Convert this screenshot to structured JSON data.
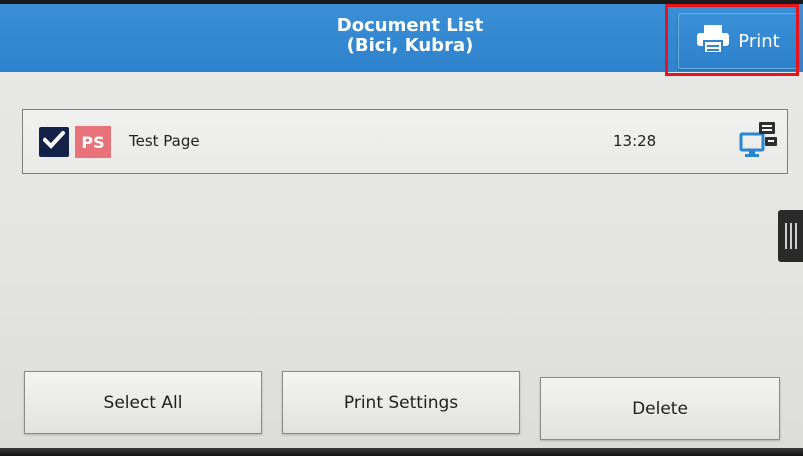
{
  "header": {
    "title_line1": "Document List",
    "title_line2": "(Bici, Kubra)",
    "print_button": {
      "label": "Print",
      "icon": "printer-icon"
    }
  },
  "documents": [
    {
      "checked": true,
      "type_badge": "PS",
      "name": "Test Page",
      "time": "13:28",
      "source_icon": "pc-monitor-icon"
    }
  ],
  "footer": {
    "select_all_label": "Select All",
    "print_settings_label": "Print Settings",
    "delete_label": "Delete"
  },
  "colors": {
    "header_blue": "#3a8fd6",
    "checkbox_navy": "#14224a",
    "ps_badge": "#e8727a",
    "highlight_red": "#e8141b",
    "icon_blue": "#2b86d1"
  }
}
